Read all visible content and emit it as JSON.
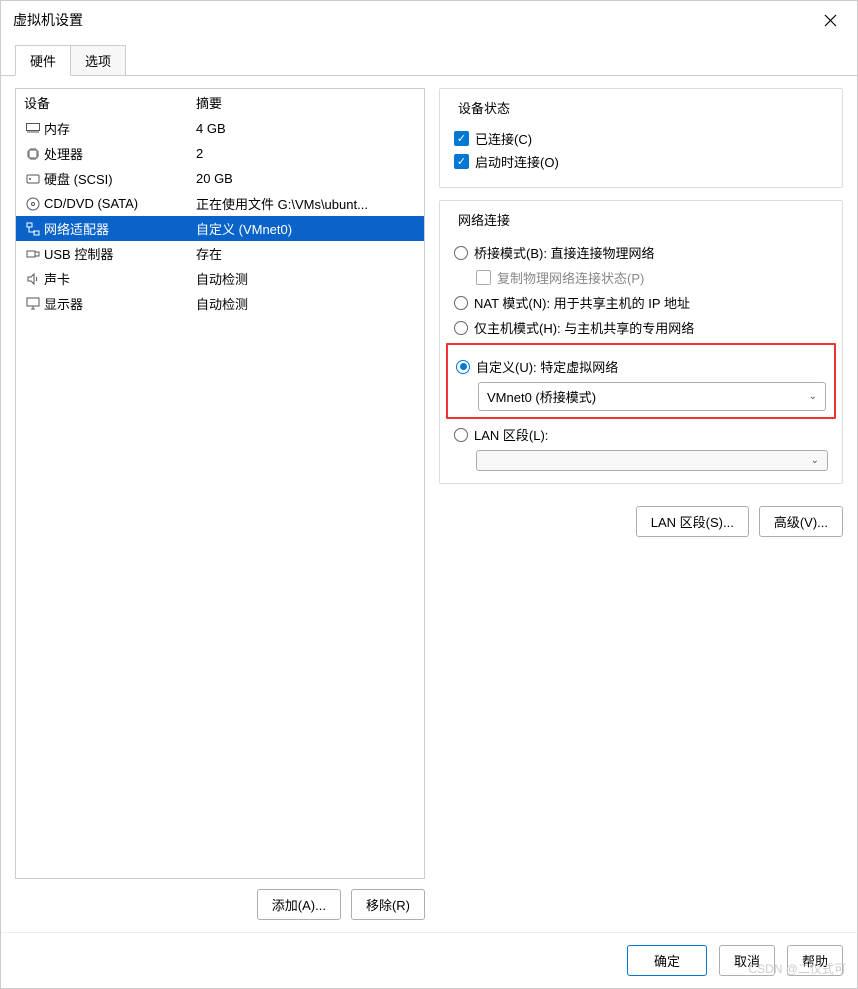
{
  "window": {
    "title": "虚拟机设置"
  },
  "tabs": {
    "hardware": "硬件",
    "options": "选项"
  },
  "device_list": {
    "header_device": "设备",
    "header_summary": "摘要",
    "rows": [
      {
        "icon": "memory",
        "name": "内存",
        "summary": "4 GB"
      },
      {
        "icon": "cpu",
        "name": "处理器",
        "summary": "2"
      },
      {
        "icon": "disk",
        "name": "硬盘 (SCSI)",
        "summary": "20 GB"
      },
      {
        "icon": "disc",
        "name": "CD/DVD (SATA)",
        "summary": "正在使用文件 G:\\VMs\\ubunt..."
      },
      {
        "icon": "net",
        "name": "网络适配器",
        "summary": "自定义 (VMnet0)"
      },
      {
        "icon": "usb",
        "name": "USB 控制器",
        "summary": "存在"
      },
      {
        "icon": "sound",
        "name": "声卡",
        "summary": "自动检测"
      },
      {
        "icon": "display",
        "name": "显示器",
        "summary": "自动检测"
      }
    ]
  },
  "left_buttons": {
    "add": "添加(A)...",
    "remove": "移除(R)"
  },
  "device_status": {
    "legend": "设备状态",
    "connected": "已连接(C)",
    "connect_at_power": "启动时连接(O)"
  },
  "network": {
    "legend": "网络连接",
    "bridged": "桥接模式(B): 直接连接物理网络",
    "replicate": "复制物理网络连接状态(P)",
    "nat": "NAT 模式(N): 用于共享主机的 IP 地址",
    "hostonly": "仅主机模式(H): 与主机共享的专用网络",
    "custom": "自定义(U): 特定虚拟网络",
    "custom_value": "VMnet0 (桥接模式)",
    "lanseg": "LAN 区段(L):",
    "lanseg_value": ""
  },
  "right_buttons": {
    "lan_segments": "LAN 区段(S)...",
    "advanced": "高级(V)..."
  },
  "footer": {
    "ok": "确定",
    "cancel": "取消",
    "help": "帮助"
  },
  "watermark": "CSDN @二仪式可"
}
